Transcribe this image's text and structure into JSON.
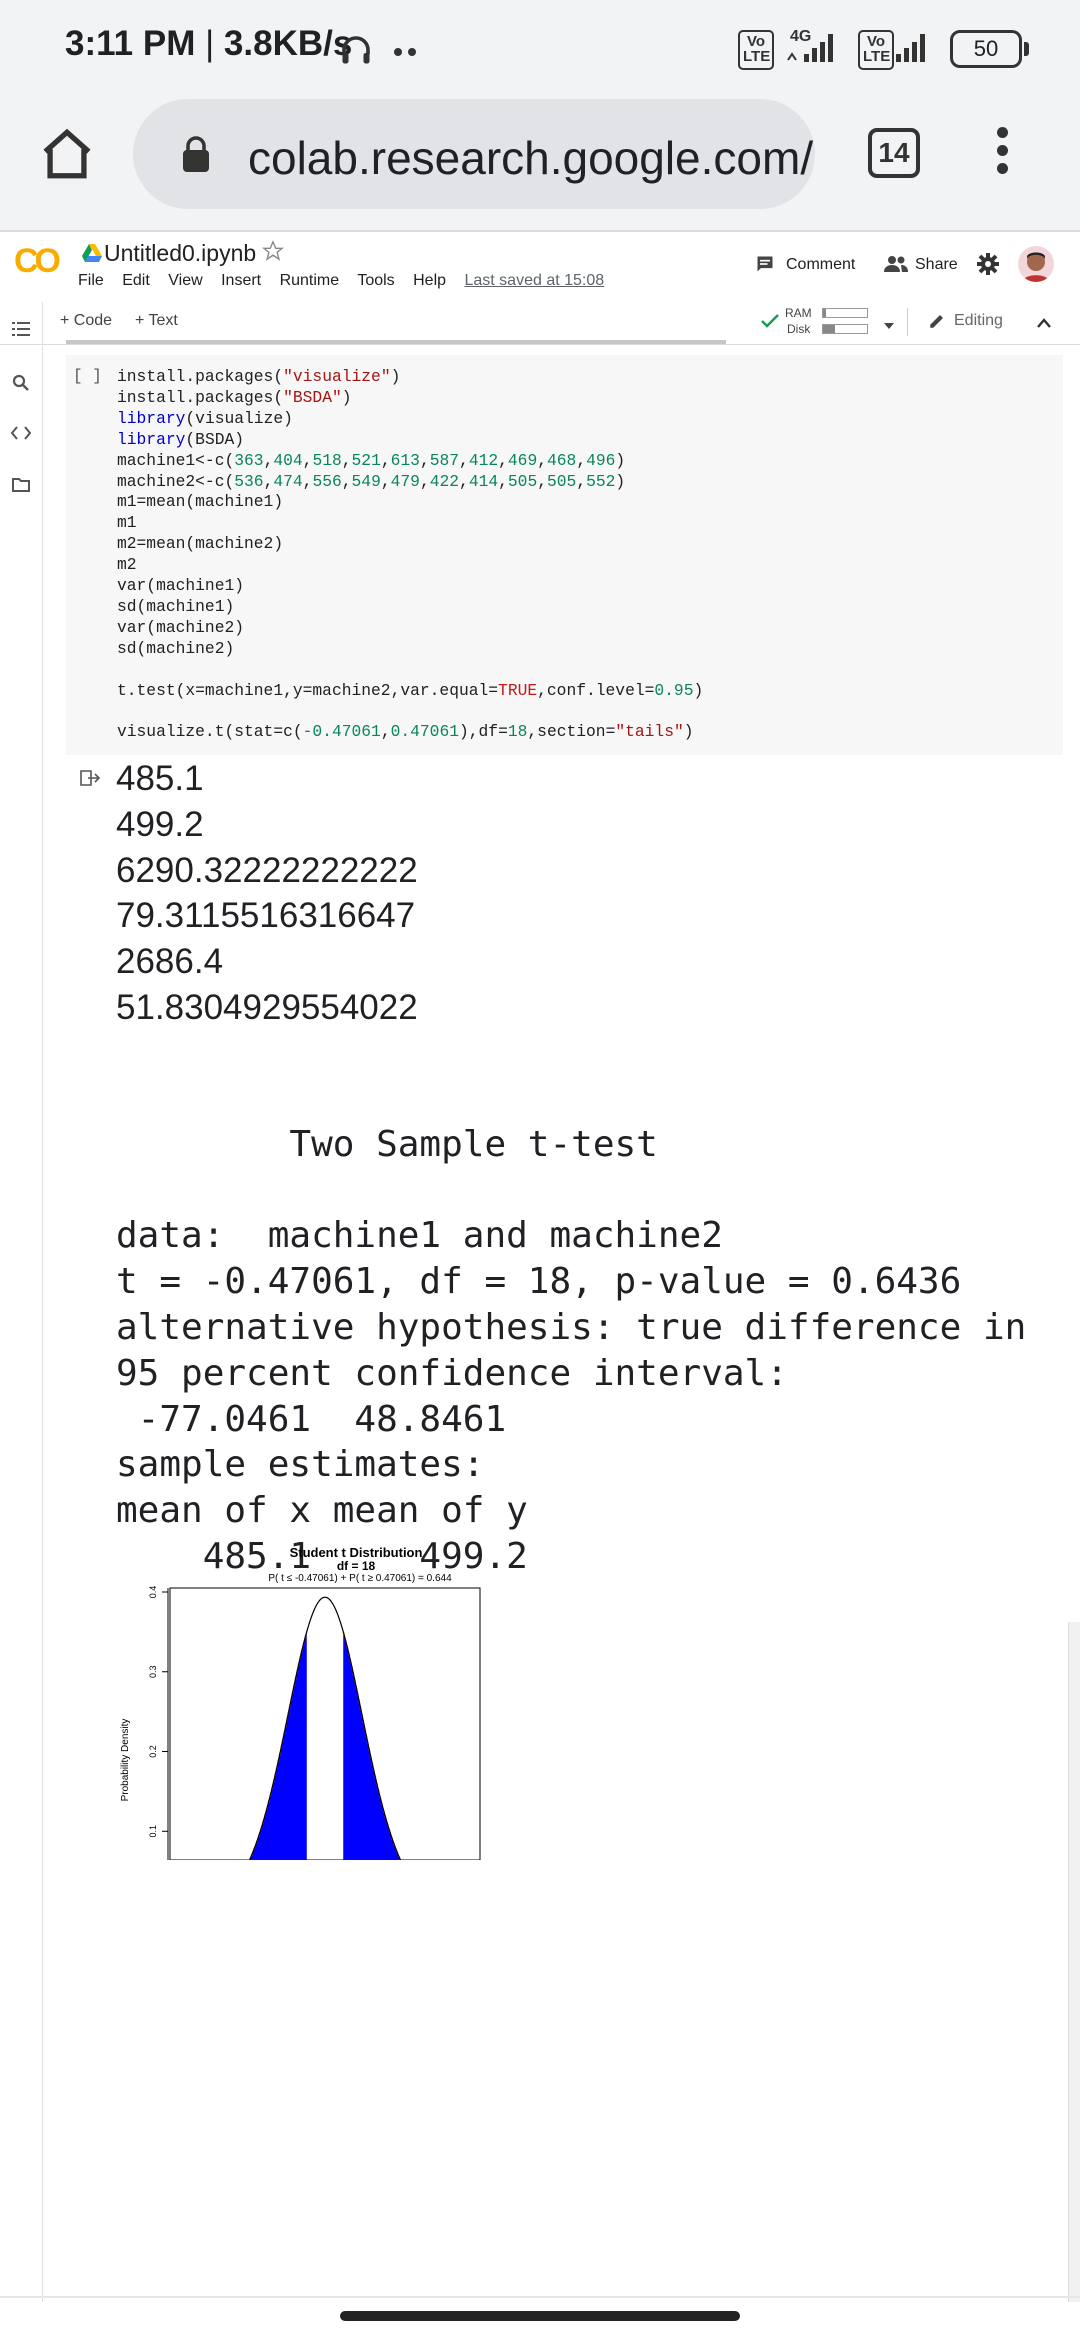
{
  "status_bar": {
    "time": "3:11 PM",
    "speed": "3.8KB/s",
    "network_label": "4G",
    "volte_label": "Vo LTE",
    "battery": "50"
  },
  "browser": {
    "url": "colab.research.google.com/",
    "tab_count": "14"
  },
  "colab": {
    "logo": "CO",
    "file_name": "Untitled0.ipynb",
    "menu": [
      "File",
      "Edit",
      "View",
      "Insert",
      "Runtime",
      "Tools",
      "Help"
    ],
    "last_saved": "Last saved at 15:08",
    "comment_label": "Comment",
    "share_label": "Share",
    "add_code_label": "+ Code",
    "add_text_label": "+ Text",
    "ram_label": "RAM",
    "disk_label": "Disk",
    "editing_label": "Editing",
    "cell_bracket": "[ ]"
  },
  "code_lines": [
    "install.packages(\"visualize\")",
    "install.packages(\"BSDA\")",
    "library(visualize)",
    "library(BSDA)",
    "machine1<-c(363,404,518,521,613,587,412,469,468,496)",
    "machine2<-c(536,474,556,549,479,422,414,505,505,552)",
    "m1=mean(machine1)",
    "m1",
    "m2=mean(machine2)",
    "m2",
    "var(machine1)",
    "sd(machine1)",
    "var(machine2)",
    "sd(machine2)",
    "",
    "t.test(x=machine1,y=machine2,var.equal=TRUE,conf.level=0.95)",
    "",
    "visualize.t(stat=c(-0.47061,0.47061),df=18,section=\"tails\")"
  ],
  "outputs": {
    "values": [
      "485.1",
      "499.2",
      "6290.32222222222",
      "79.3115516316647",
      "2686.4",
      "51.8304929554022"
    ],
    "ttest": [
      "",
      "\tTwo Sample t-test",
      "",
      "data:  machine1 and machine2",
      "t = -0.47061, df = 18, p-value = 0.6436",
      "alternative hypothesis: true difference in",
      "95 percent confidence interval:",
      " -77.0461  48.8461",
      "sample estimates:",
      "mean of x mean of y ",
      "    485.1     499.2 "
    ]
  },
  "chart_data": {
    "type": "area",
    "title": "Student t Distribution",
    "subtitle": "df = 18",
    "annotation": "P( t ≤ -0.47061) + P( t ≥ 0.47061) = 0.644",
    "ylabel": "Probability Density",
    "yticks": [
      0.1,
      0.2,
      0.3,
      0.4
    ],
    "df": 18,
    "stat": [
      -0.47061,
      0.47061
    ],
    "shade_color": "#0000ff",
    "boundary_color": "#ff8800"
  },
  "colors": {
    "accent_orange": "#f9ab00",
    "colab_blue": "#1a73e8"
  }
}
